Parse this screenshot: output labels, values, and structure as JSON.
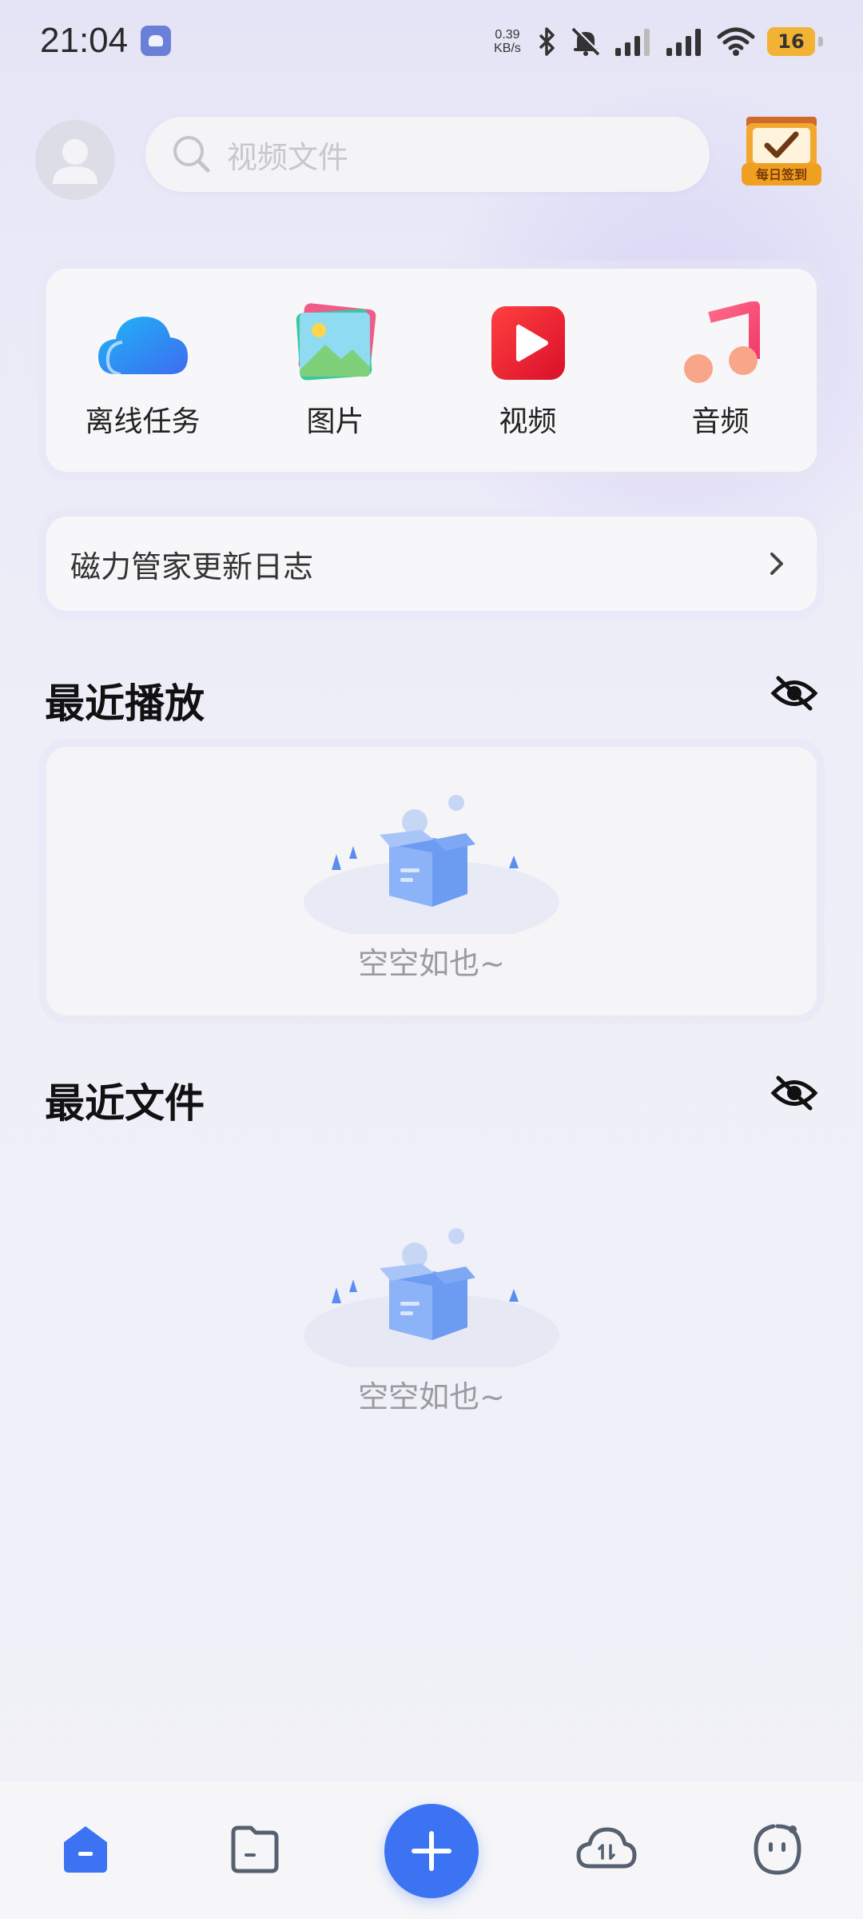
{
  "status_bar": {
    "time": "21:04",
    "net_speed_value": "0.39",
    "net_speed_unit": "KB/s",
    "battery": "16",
    "icons": [
      "bluetooth-icon",
      "mute-bell-icon",
      "signal-icon",
      "signal-icon",
      "wifi-icon"
    ]
  },
  "header": {
    "search_placeholder": "视频文件",
    "checkin_label": "每日签到"
  },
  "quick_tiles": [
    {
      "label": "离线任务",
      "icon": "cloud-icon"
    },
    {
      "label": "图片",
      "icon": "image-icon"
    },
    {
      "label": "视频",
      "icon": "video-play-icon"
    },
    {
      "label": "音频",
      "icon": "music-note-icon"
    }
  ],
  "changelog": {
    "label": "磁力管家更新日志"
  },
  "recent_play": {
    "title": "最近播放",
    "empty_text": "空空如也~"
  },
  "recent_files": {
    "title": "最近文件",
    "empty_text": "空空如也~"
  },
  "bottom_nav": {
    "items": [
      "home-icon",
      "folder-icon",
      "add-icon",
      "cloud-transfer-icon",
      "profile-icon"
    ]
  },
  "colors": {
    "accent": "#3b73f3",
    "battery": "#f2b233"
  }
}
